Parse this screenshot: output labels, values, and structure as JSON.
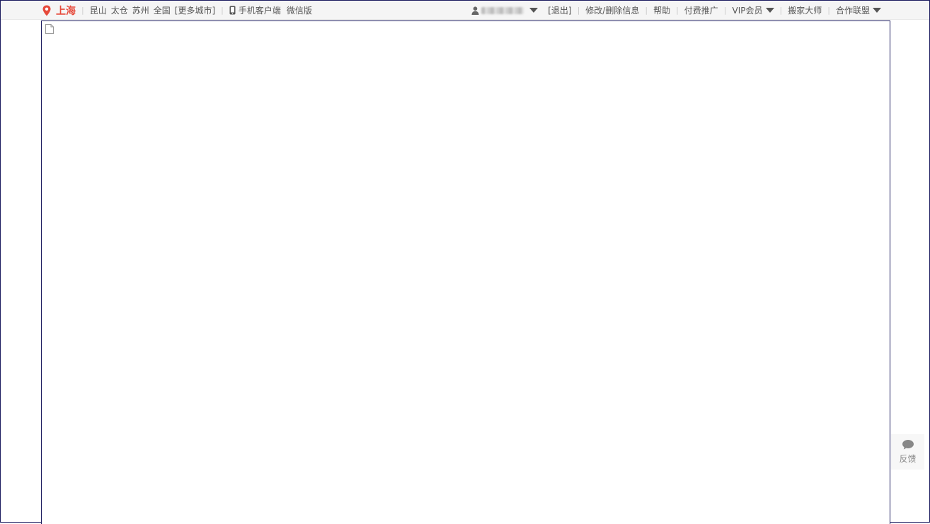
{
  "topbar": {
    "current_city": "上海",
    "nearby_cities": [
      "昆山",
      "太仓",
      "苏州",
      "全国"
    ],
    "more_cities": "[更多城市]",
    "mobile_client": "手机客户端",
    "wechat_version": "微信版",
    "logout": "[退出]",
    "edit_delete": "修改/删除信息",
    "help": "帮助",
    "paid_promotion": "付费推广",
    "vip_member": "VIP会员",
    "moving_master": "搬家大师",
    "partner_alliance": "合作联盟"
  },
  "feedback": {
    "label": "反馈"
  },
  "icons": {
    "location": "map-pin-icon",
    "phone": "phone-icon",
    "user": "user-icon",
    "dropdown": "caret-down-icon",
    "broken_image": "broken-image-icon",
    "chat": "chat-bubble-icon"
  },
  "colors": {
    "accent": "#e64a3b",
    "border": "#1a1a5e",
    "topbar_bg": "#f5f5f5"
  }
}
